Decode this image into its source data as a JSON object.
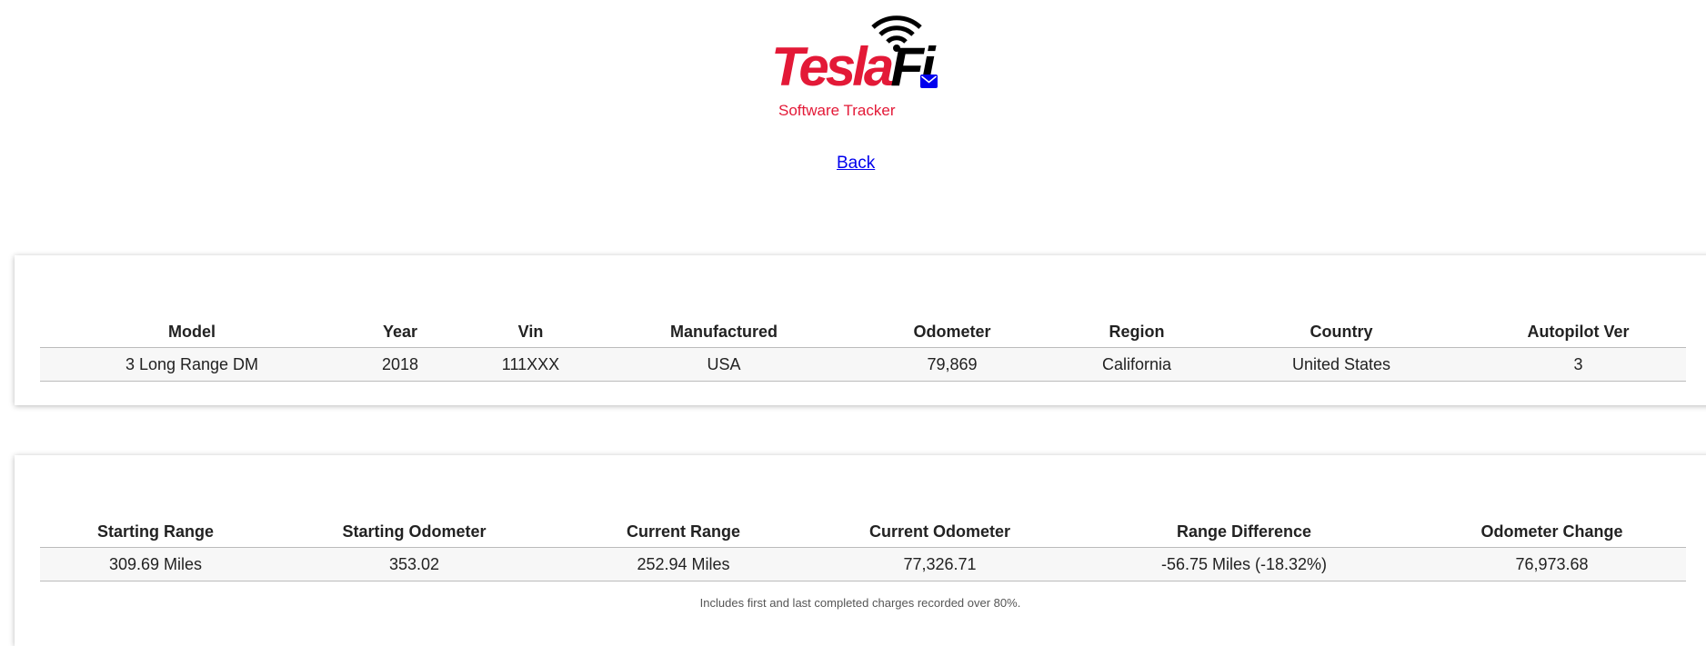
{
  "brand": {
    "logo_text_red": "Tesla",
    "logo_text_black": "Fi",
    "tagline": "Software Tracker",
    "colors": {
      "red": "#e31937",
      "black": "#000000",
      "link": "#0000ee"
    }
  },
  "header": {
    "mail_icon": "envelope-icon",
    "back_label": "Back"
  },
  "vehicle": {
    "columns": [
      "Model",
      "Year",
      "Vin",
      "Manufactured",
      "Odometer",
      "Region",
      "Country",
      "Autopilot Ver"
    ],
    "rows": [
      [
        "3 Long Range DM",
        "2018",
        "111XXX",
        "USA",
        "79,869",
        "California",
        "United States",
        "3"
      ]
    ]
  },
  "range": {
    "columns": [
      "Starting Range",
      "Starting Odometer",
      "Current Range",
      "Current Odometer",
      "Range Difference",
      "Odometer Change"
    ],
    "rows": [
      [
        "309.69 Miles",
        "353.02",
        "252.94 Miles",
        "77,326.71",
        "-56.75 Miles (-18.32%)",
        "76,973.68"
      ]
    ],
    "footnote": "Includes first and last completed charges recorded over 80%."
  }
}
